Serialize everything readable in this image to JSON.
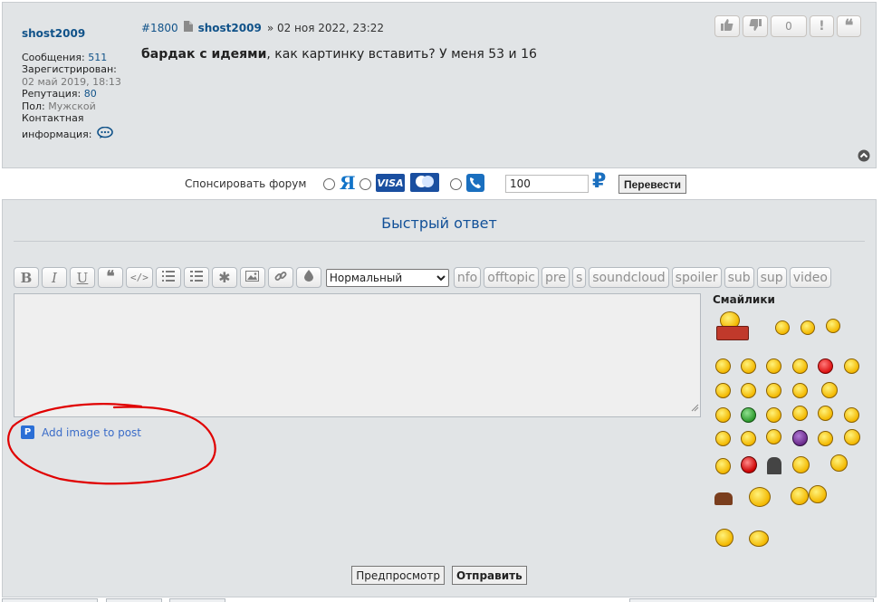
{
  "post": {
    "number": "#1800",
    "author": "shost2009",
    "date": "» 02 ноя 2022, 23:22",
    "body_bold": "бардак с идеями",
    "body_rest": ", как картинку вставить? У меня 53 и 16",
    "rating_count": "0",
    "profile": {
      "username": "shost2009",
      "posts_label": "Сообщения:",
      "posts_value": "511",
      "registered_label": "Зарегистрирован:",
      "registered_value": "02 май 2019, 18:13",
      "reputation_label": "Репутация:",
      "reputation_value": "80",
      "gender_label": "Пол:",
      "gender_value": "Мужской",
      "contact_label_1": "Контактная",
      "contact_label_2": "информация:"
    }
  },
  "sponsor": {
    "label": "Спонсировать форум",
    "yandex_glyph": "Я",
    "visa_label": "VISA",
    "amount": "100",
    "currency": "₽",
    "transfer_button": "Перевести"
  },
  "quick_reply": {
    "title": "Быстрый ответ",
    "format_selected": "Нормальный",
    "text_buttons": [
      "nfo",
      "offtopic",
      "pre",
      "s",
      "soundcloud",
      "spoiler",
      "sub",
      "sup",
      "video"
    ],
    "add_image_label": "Add image to post",
    "smilies_title": "Смайлики",
    "preview_button": "Предпросмотр",
    "submit_button": "Отправить"
  },
  "colors": {
    "panel_bg": "#e1e4e6",
    "link": "#105289",
    "title": "#115098",
    "annotation": "#e00000",
    "smiley": "#f3b800"
  },
  "icons": {
    "post_actions": [
      "thumbs-up-icon",
      "thumbs-down-icon",
      "exclamation-icon",
      "quote-icon"
    ],
    "toolbar": [
      "bold-icon",
      "italic-icon",
      "underline-icon",
      "quote-icon",
      "code-icon",
      "list-icon",
      "ordered-list-icon",
      "asterisk-icon",
      "image-icon",
      "link-icon",
      "color-icon"
    ]
  }
}
